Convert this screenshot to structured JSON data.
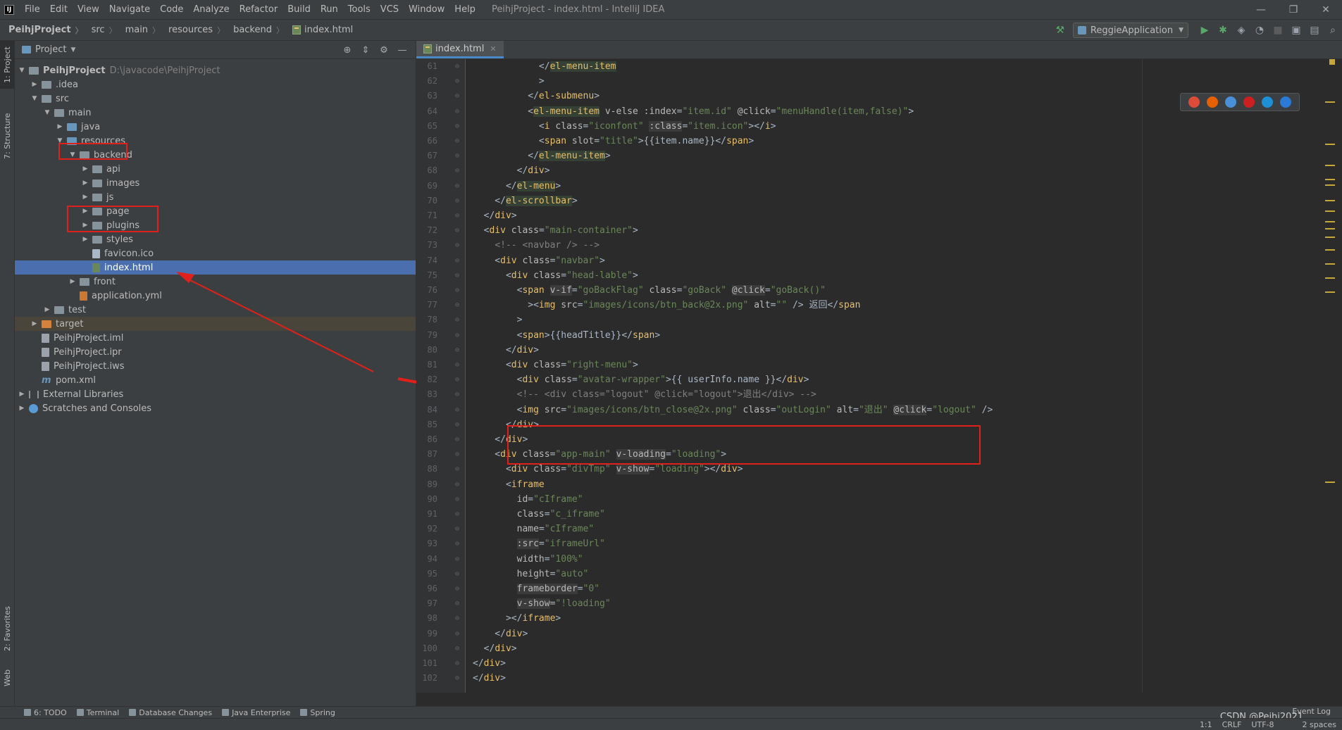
{
  "window": {
    "title": "PeihjProject - index.html - IntelliJ IDEA",
    "logo": "IJ",
    "menu": [
      "File",
      "Edit",
      "View",
      "Navigate",
      "Code",
      "Analyze",
      "Refactor",
      "Build",
      "Run",
      "Tools",
      "VCS",
      "Window",
      "Help"
    ],
    "controls": {
      "minimize": "—",
      "restore": "❐",
      "close": "✕"
    }
  },
  "navbar": {
    "breadcrumbs": [
      "PeihjProject",
      "src",
      "main",
      "resources",
      "backend",
      "index.html"
    ],
    "run_config": "ReggieApplication"
  },
  "left_strip": {
    "project_tab": "1: Project",
    "structure_tab": "7: Structure",
    "favorites_tab": "2: Favorites",
    "web_tab": "Web"
  },
  "project_panel": {
    "title": "Project",
    "tree": [
      {
        "label": "PeihjProject",
        "hint": "D:\\javacode\\PeihjProject",
        "depth": 0,
        "arrow": "▼",
        "icon": "folder"
      },
      {
        "label": ".idea",
        "depth": 1,
        "arrow": "▶",
        "icon": "folder"
      },
      {
        "label": "src",
        "depth": 1,
        "arrow": "▼",
        "icon": "folder"
      },
      {
        "label": "main",
        "depth": 2,
        "arrow": "▼",
        "icon": "folder"
      },
      {
        "label": "java",
        "depth": 3,
        "arrow": "▶",
        "icon": "folder-blue"
      },
      {
        "label": "resources",
        "depth": 3,
        "arrow": "▼",
        "icon": "folder-blue"
      },
      {
        "label": "backend",
        "depth": 4,
        "arrow": "▼",
        "icon": "folder"
      },
      {
        "label": "api",
        "depth": 5,
        "arrow": "▶",
        "icon": "folder"
      },
      {
        "label": "images",
        "depth": 5,
        "arrow": "▶",
        "icon": "folder"
      },
      {
        "label": "js",
        "depth": 5,
        "arrow": "▶",
        "icon": "folder"
      },
      {
        "label": "page",
        "depth": 5,
        "arrow": "▶",
        "icon": "folder"
      },
      {
        "label": "plugins",
        "depth": 5,
        "arrow": "▶",
        "icon": "folder"
      },
      {
        "label": "styles",
        "depth": 5,
        "arrow": "▶",
        "icon": "folder"
      },
      {
        "label": "favicon.ico",
        "depth": 5,
        "arrow": "",
        "icon": "file-ico"
      },
      {
        "label": "index.html",
        "depth": 5,
        "arrow": "",
        "icon": "file-html",
        "selected": true
      },
      {
        "label": "front",
        "depth": 4,
        "arrow": "▶",
        "icon": "folder"
      },
      {
        "label": "application.yml",
        "depth": 4,
        "arrow": "",
        "icon": "file-yml"
      },
      {
        "label": "test",
        "depth": 2,
        "arrow": "▶",
        "icon": "folder"
      },
      {
        "label": "target",
        "depth": 1,
        "arrow": "▶",
        "icon": "folder-orange",
        "excluded": true
      },
      {
        "label": "PeihjProject.iml",
        "depth": 1,
        "arrow": "",
        "icon": "file"
      },
      {
        "label": "PeihjProject.ipr",
        "depth": 1,
        "arrow": "",
        "icon": "file"
      },
      {
        "label": "PeihjProject.iws",
        "depth": 1,
        "arrow": "",
        "icon": "file"
      },
      {
        "label": "pom.xml",
        "depth": 1,
        "arrow": "",
        "icon": "file-maven"
      },
      {
        "label": "External Libraries",
        "depth": 0,
        "arrow": "▶",
        "icon": "folder-lib"
      },
      {
        "label": "Scratches and Consoles",
        "depth": 0,
        "arrow": "▶",
        "icon": "scratch"
      }
    ]
  },
  "editor": {
    "tab": "index.html",
    "lines": [
      {
        "n": "61",
        "html": "            &lt;/<span class='tg hl'>el-menu-item</span>"
      },
      {
        "n": "62",
        "html": "            &gt;"
      },
      {
        "n": "63",
        "html": "          &lt;/<span class='tg'>el-submenu</span>&gt;"
      },
      {
        "n": "64",
        "html": "          &lt;<span class='tg hl'>el-menu-item</span> <span class='at'>v-else</span> <span class='at'>:index</span>=<span class='st'>\"item.id\"</span> <span class='at'>@click</span>=<span class='st'>\"menuHandle(item,false)\"</span>&gt;"
      },
      {
        "n": "65",
        "html": "            &lt;<span class='tg'>i</span> <span class='at'>class</span>=<span class='st'>\"iconfont\"</span> <span class='at attr-hl'>:class</span>=<span class='st'>\"item.icon\"</span>&gt;&lt;/<span class='tg'>i</span>&gt;"
      },
      {
        "n": "66",
        "html": "            &lt;<span class='tg'>span</span> <span class='at'>slot</span>=<span class='st'>\"title\"</span>&gt;{{item.name}}&lt;/<span class='tg'>span</span>&gt;"
      },
      {
        "n": "67",
        "html": "          &lt;/<span class='tg hl'>el-menu-item</span>&gt;"
      },
      {
        "n": "68",
        "html": "        &lt;/<span class='tg'>div</span>&gt;"
      },
      {
        "n": "69",
        "html": "      &lt;/<span class='tg hl'>el-menu</span>&gt;"
      },
      {
        "n": "70",
        "html": "    &lt;/<span class='tg hl'>el-scrollbar</span>&gt;"
      },
      {
        "n": "71",
        "html": "  &lt;/<span class='tg'>div</span>&gt;"
      },
      {
        "n": "72",
        "html": "  &lt;<span class='tg'>div</span> <span class='at'>class</span>=<span class='st'>\"main-container\"</span>&gt;"
      },
      {
        "n": "73",
        "html": "    <span class='cm'>&lt;!-- &lt;navbar /&gt; --&gt;</span>"
      },
      {
        "n": "74",
        "html": "    &lt;<span class='tg'>div</span> <span class='at'>class</span>=<span class='st'>\"navbar\"</span>&gt;"
      },
      {
        "n": "75",
        "html": "      &lt;<span class='tg'>div</span> <span class='at'>class</span>=<span class='st'>\"head-lable\"</span>&gt;"
      },
      {
        "n": "76",
        "html": "        &lt;<span class='tg'>span</span> <span class='at attr-hl'>v-if</span>=<span class='st'>\"goBackFlag\"</span> <span class='at'>class</span>=<span class='st'>\"goBack\"</span> <span class='at attr-hl'>@click</span>=<span class='st'>\"goBack()\"</span>"
      },
      {
        "n": "77",
        "html": "          &gt;&lt;<span class='tg'>img</span> <span class='at'>src</span>=<span class='st'>\"images/icons/btn_back@2x.png\"</span> <span class='at'>alt</span>=<span class='st'>\"\"</span> /&gt; 返回&lt;/<span class='tg'>span</span>"
      },
      {
        "n": "78",
        "html": "        &gt;"
      },
      {
        "n": "79",
        "html": "        &lt;<span class='tg'>span</span>&gt;{{headTitle}}&lt;/<span class='tg'>span</span>&gt;"
      },
      {
        "n": "80",
        "html": "      &lt;/<span class='tg'>div</span>&gt;"
      },
      {
        "n": "81",
        "html": "      &lt;<span class='tg'>div</span> <span class='at'>class</span>=<span class='st'>\"right-menu\"</span>&gt;"
      },
      {
        "n": "82",
        "html": "        &lt;<span class='tg'>div</span> <span class='at'>class</span>=<span class='st'>\"avatar-wrapper\"</span>&gt;{{ userInfo.name }}&lt;/<span class='tg'>div</span>&gt;"
      },
      {
        "n": "83",
        "html": "        <span class='cm'>&lt;!-- &lt;div class=\"logout\" @click=\"logout\"&gt;退出&lt;/div&gt; --&gt;</span>"
      },
      {
        "n": "84",
        "html": "        &lt;<span class='tg'>img</span> <span class='at'>src</span>=<span class='st'>\"images/icons/btn_close@2x.png\"</span> <span class='at'>class</span>=<span class='st'>\"outLogin\"</span> <span class='at'>alt</span>=<span class='st'>\"退出\"</span> <span class='at attr-hl'>@click</span>=<span class='st'>\"logout\"</span> /&gt;"
      },
      {
        "n": "85",
        "html": "      &lt;/<span class='tg'>div</span>&gt;"
      },
      {
        "n": "86",
        "html": "    &lt;/<span class='tg'>div</span>&gt;"
      },
      {
        "n": "87",
        "html": "    &lt;<span class='tg'>div</span> <span class='at'>class</span>=<span class='st'>\"app-main\"</span> <span class='at attr-hl'>v-loading</span>=<span class='st'>\"loading\"</span>&gt;"
      },
      {
        "n": "88",
        "html": "      &lt;<span class='tg'>div</span> <span class='at'>class</span>=<span class='st'>\"divTmp\"</span> <span class='at attr-hl'>v-show</span>=<span class='st'>\"loading\"</span>&gt;&lt;/<span class='tg'>div</span>&gt;"
      },
      {
        "n": "89",
        "html": "      &lt;<span class='tg'>iframe</span>"
      },
      {
        "n": "90",
        "html": "        <span class='at'>id</span>=<span class='st'>\"cIframe\"</span>"
      },
      {
        "n": "91",
        "html": "        <span class='at'>class</span>=<span class='st'>\"c_iframe\"</span>"
      },
      {
        "n": "92",
        "html": "        <span class='at'>name</span>=<span class='st'>\"cIframe\"</span>"
      },
      {
        "n": "93",
        "html": "        <span class='at attr-hl'>:src</span>=<span class='st'>\"iframeUrl\"</span>"
      },
      {
        "n": "94",
        "html": "        <span class='at'>width</span>=<span class='st'>\"100%\"</span>"
      },
      {
        "n": "95",
        "html": "        <span class='at'>height</span>=<span class='st'>\"auto\"</span>"
      },
      {
        "n": "96",
        "html": "        <span class='at attr-hl'>frameborder</span>=<span class='st'>\"0\"</span>"
      },
      {
        "n": "97",
        "html": "        <span class='at attr-hl'>v-show</span>=<span class='st'>\"!loading\"</span>"
      },
      {
        "n": "98",
        "html": "      &gt;&lt;/<span class='tg'>iframe</span>&gt;"
      },
      {
        "n": "99",
        "html": "    &lt;/<span class='tg'>div</span>&gt;"
      },
      {
        "n": "100",
        "html": "  &lt;/<span class='tg'>div</span>&gt;"
      },
      {
        "n": "101",
        "html": "&lt;/<span class='tg'>div</span>&gt;"
      },
      {
        "n": "102",
        "html": "&lt;/<span class='tg'>div</span>&gt;"
      }
    ]
  },
  "bottom_tools": [
    "6: TODO",
    "Terminal",
    "Database Changes",
    "Java Enterprise",
    "Spring"
  ],
  "status": {
    "event_log": "Event Log",
    "position": "1:1",
    "line_sep": "CRLF",
    "encoding": "UTF-8",
    "indent": "2 spaces",
    "watermark": "CSDN @Peihj2021"
  },
  "colors": {
    "accent_selection": "#4b6eaf",
    "annotation_red": "#e0201a",
    "tag": "#e8bf6a",
    "string": "#6a8759"
  }
}
